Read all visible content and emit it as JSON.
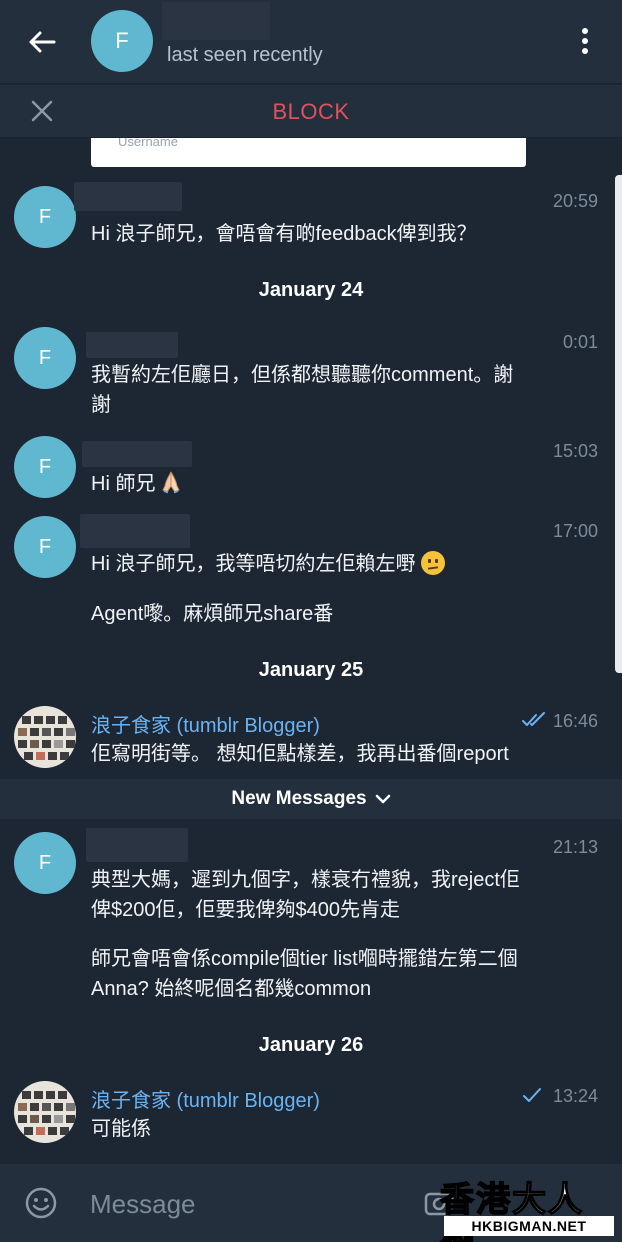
{
  "header": {
    "avatar_letter": "F",
    "status": "last seen recently"
  },
  "block_bar": {
    "label": "BLOCK"
  },
  "username_card": {
    "placeholder": "Username"
  },
  "messages": [
    {
      "avatar_letter": "F",
      "time": "20:59",
      "text": "Hi 浪子師兄，會唔會有啲feedback俾到我？"
    },
    {
      "avatar_letter": "F",
      "time": "0:01",
      "text_line1": "我暫約左佢廳日，但係都想聽聽你comment。謝",
      "text_line2": "謝"
    },
    {
      "avatar_letter": "F",
      "time": "15:03",
      "text": "Hi 師兄"
    },
    {
      "avatar_letter": "F",
      "time": "17:00",
      "text": "Hi 浪子師兄，我等唔切約左佢賴左嘢",
      "text2": "Agent嚟。麻煩師兄share番"
    },
    {
      "sender": "浪子食家 (tumblr Blogger)",
      "time": "16:46",
      "text": "佢寫明街等。 想知佢點樣差，我再出番個report"
    },
    {
      "avatar_letter": "F",
      "time": "21:13",
      "text_line1": "典型大媽，遲到九個字，樣衰冇禮貌，我reject佢",
      "text_line2": "俾$200佢，佢要我俾夠$400先肯走",
      "text2_line1": "師兄會唔會係compile個tier list嗰時擺錯左第二個",
      "text2_line2": "Anna? 始終呢個名都幾common"
    },
    {
      "sender": "浪子食家 (tumblr Blogger)",
      "time": "13:24",
      "text": "可能係"
    }
  ],
  "dates": [
    "January 24",
    "January 25",
    "January 26"
  ],
  "new_messages_label": "New Messages",
  "input": {
    "placeholder": "Message"
  },
  "watermark": {
    "title": "香港大人網",
    "url": "HKBIGMAN.NET"
  },
  "colors": {
    "background": "#1d2733",
    "bar": "#242f3d",
    "avatar": "#5fb8cf",
    "block_red": "#e0525c",
    "sender_blue": "#6ab3f3",
    "time_gray": "#7d8b99"
  }
}
